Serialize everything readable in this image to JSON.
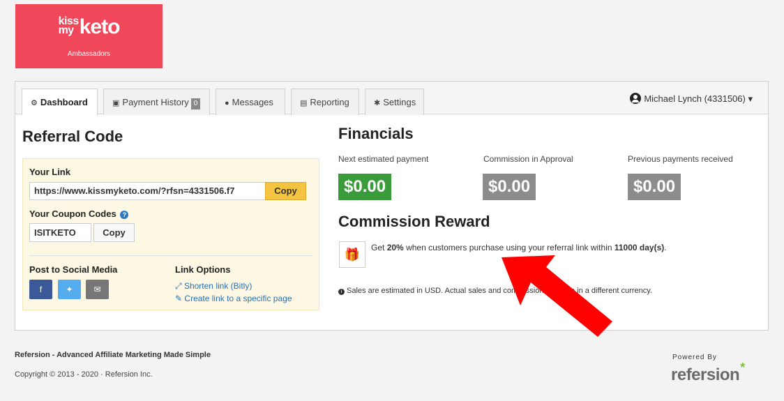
{
  "brand": {
    "top": "kiss",
    "middle": "my",
    "name": "keto",
    "subtitle": "Ambassadors"
  },
  "tabs": [
    {
      "label": "Dashboard",
      "icon": "dashboard-icon"
    },
    {
      "label": "Payment History",
      "icon": "money-icon",
      "badge": "0"
    },
    {
      "label": "Messages",
      "icon": "comment-icon"
    },
    {
      "label": "Reporting",
      "icon": "bar-chart-icon"
    },
    {
      "label": "Settings",
      "icon": "gear-icon"
    }
  ],
  "user": {
    "name": "Michael Lynch (4331506)",
    "caret": "▾"
  },
  "referral": {
    "title": "Referral Code",
    "your_link_label": "Your Link",
    "link_value": "https://www.kissmyketo.com/?rfsn=4331506.f7",
    "copy_label": "Copy",
    "coupon_label": "Your Coupon Codes",
    "coupon_value": "ISITKETO",
    "coupon_copy_label": "Copy",
    "social_label": "Post to Social Media",
    "link_options_label": "Link Options",
    "shorten_label": "Shorten link (Bitly)",
    "create_link_label": "Create link to a specific page"
  },
  "financials": {
    "title": "Financials",
    "items": [
      {
        "label": "Next estimated payment",
        "amount": "$0.00",
        "color": "#3a9b3a"
      },
      {
        "label": "Commission in Approval",
        "amount": "$0.00",
        "color": "#8c8c8c"
      },
      {
        "label": "Previous payments received",
        "amount": "$0.00",
        "color": "#8c8c8c"
      }
    ]
  },
  "commission": {
    "title": "Commission Reward",
    "get": "Get",
    "percent": "20%",
    "mid": "when customers purchase using your referral link within",
    "days": "11000 day(s)",
    "end": ".",
    "note": "Sales are estimated in USD. Actual sales and commissions may be in a different currency."
  },
  "footer": {
    "tagline": "Refersion - Advanced Affiliate Marketing Made Simple",
    "copyright": "Copyright © 2013 - 2020 · Refersion Inc.",
    "powered_by": "Powered By",
    "refersion": "refersion"
  },
  "annotation": {
    "arrow_color": "#ff0000"
  }
}
